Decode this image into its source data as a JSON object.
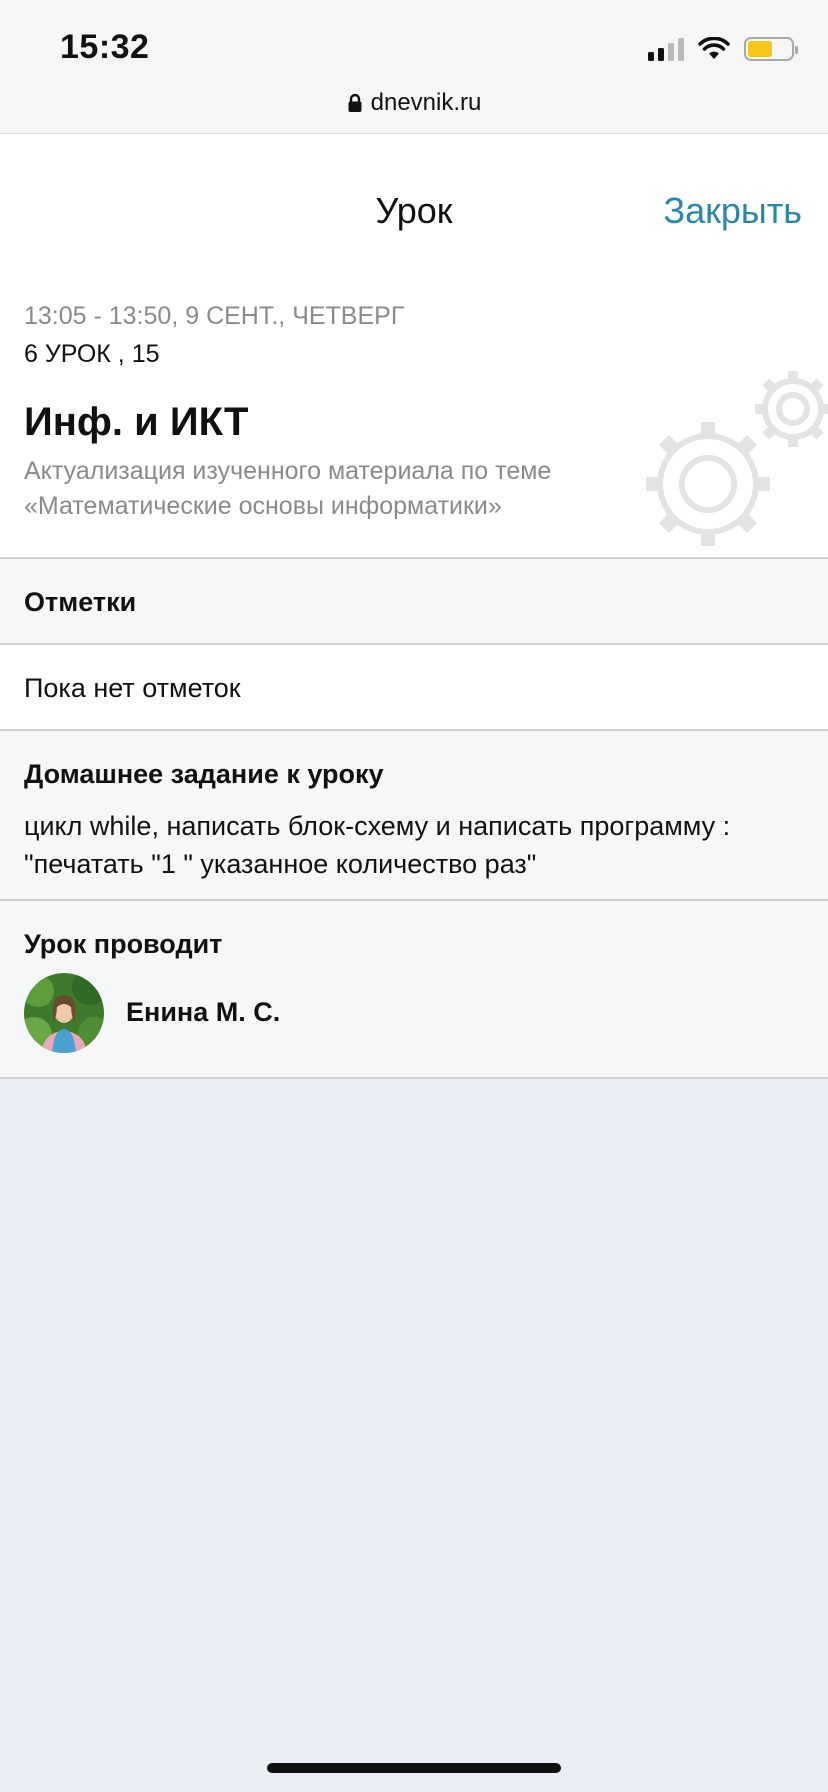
{
  "status_bar": {
    "time": "15:32",
    "battery_color": "#f5c518",
    "signal_bars_active": 2
  },
  "browser": {
    "url": "dnevnik.ru",
    "lock_icon": "lock-icon"
  },
  "header": {
    "title": "Урок",
    "close_label": "Закрыть",
    "accent_color": "#2b87a8"
  },
  "lesson": {
    "time": "13:05 - 13:50, 9 СЕНТ., ЧЕТВЕРГ",
    "number": "6 УРОК , 15",
    "subject": "Инф. и ИКТ",
    "topic": "Актуализация изученного материала по теме «Математические основы информатики»",
    "decoration_icon": "gears-icon"
  },
  "marks": {
    "title": "Отметки",
    "empty_text": "Пока нет отметок"
  },
  "homework": {
    "title": "Домашнее задание к уроку",
    "text": "цикл while, написать блок-схему и написать программу : \"печатать \"1 \" указанное количество раз\""
  },
  "teacher": {
    "title": "Урок проводит",
    "name": "Енина М. С."
  }
}
